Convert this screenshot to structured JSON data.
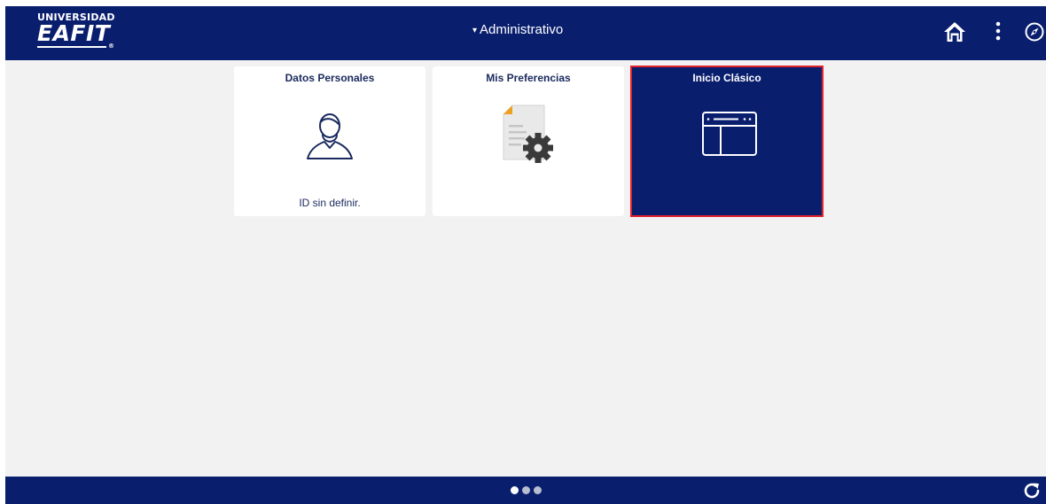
{
  "header": {
    "logo": {
      "line1": "UNIVERSIDAD",
      "line2": "EAFIT",
      "mark": "®"
    },
    "homepage_selector": {
      "caret": "▾",
      "label": "Administrativo"
    },
    "icons": [
      "home-icon",
      "actions-menu-icon",
      "navbar-compass-icon"
    ]
  },
  "tiles": [
    {
      "title": "Datos Personales",
      "footer": "ID sin definir.",
      "icon": "person-icon"
    },
    {
      "title": "Mis Preferencias",
      "footer": "",
      "icon": "document-gear-icon"
    },
    {
      "title": "Inicio Clásico",
      "footer": "",
      "icon": "classic-window-icon",
      "selected": true
    }
  ],
  "footer": {
    "page_dots": 3,
    "active_dot": 1,
    "icons": [
      "refresh-icon"
    ]
  },
  "colors": {
    "brand": "#0a1e6e",
    "background": "#f2f2f2",
    "selection_border": "#e0202a",
    "tile_text": "#1a2a5e"
  }
}
